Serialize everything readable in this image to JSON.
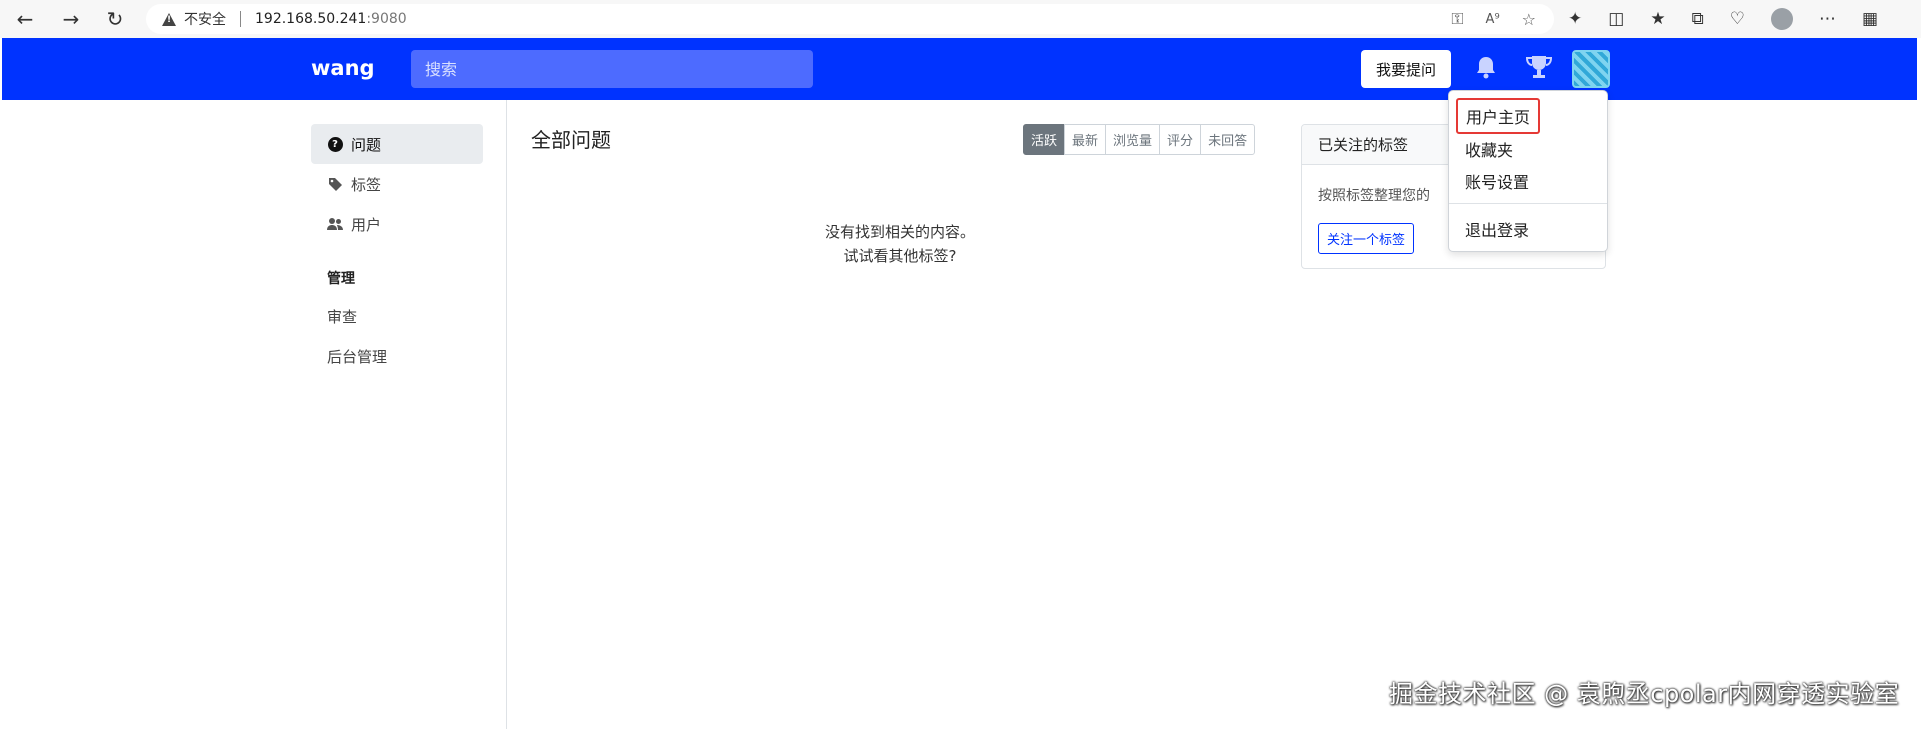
{
  "browser": {
    "security_label": "不安全",
    "url_host": "192.168.50.241",
    "url_port": ":9080"
  },
  "header": {
    "brand": "wang",
    "search_placeholder": "搜索",
    "ask_button": "我要提问",
    "accent_color": "#0033ff"
  },
  "sidebar": {
    "items": [
      {
        "label": "问题",
        "icon": "question-circle-icon",
        "active": true
      },
      {
        "label": "标签",
        "icon": "tag-icon",
        "active": false
      },
      {
        "label": "用户",
        "icon": "users-icon",
        "active": false
      }
    ],
    "admin_section_title": "管理",
    "admin_links": [
      "审查",
      "后台管理"
    ]
  },
  "main": {
    "title": "全部问题",
    "filters": [
      "活跃",
      "最新",
      "浏览量",
      "评分",
      "未回答"
    ],
    "active_filter": "活跃",
    "empty_line1": "没有找到相关的内容。",
    "empty_line2": "试试看其他标签?"
  },
  "tags_card": {
    "title": "已关注的标签",
    "description": "按照标签整理您的",
    "follow_button": "关注一个标签"
  },
  "user_menu": {
    "items": [
      "用户主页",
      "收藏夹",
      "账号设置"
    ],
    "logout": "退出登录",
    "highlight_color": "#e53935"
  },
  "watermark": "掘金技术社区 @ 袁煦丞cpolar内网穿透实验室"
}
